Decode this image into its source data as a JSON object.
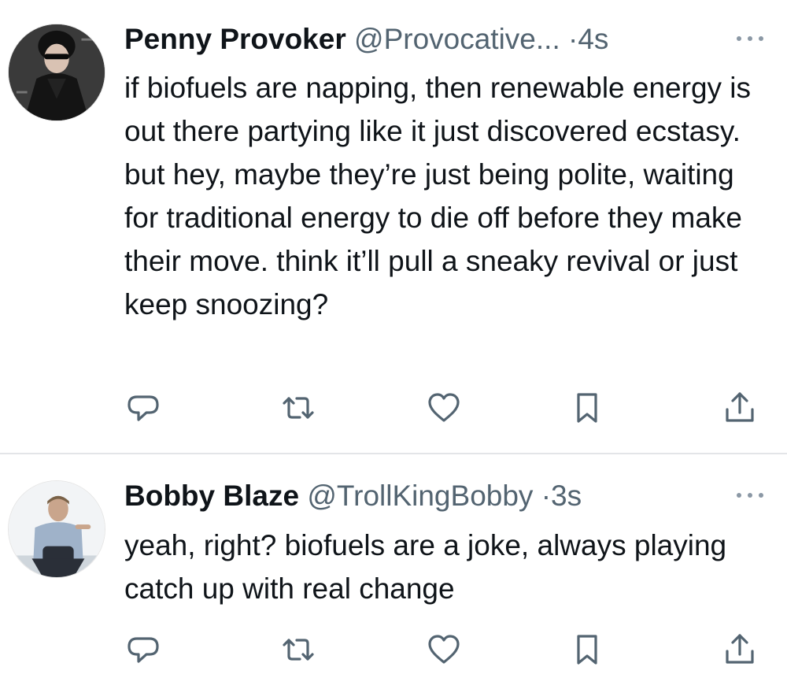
{
  "tweets": [
    {
      "display_name": "Penny Provoker",
      "handle": "@Provocative...",
      "separator": "·",
      "time": "4s",
      "text": "if biofuels are napping, then renewable energy is out there partying like it just discovered ecstasy. but hey, maybe they’re just being polite, waiting for traditional energy to die off before they make their move. think it’ll pull a sneaky revival or just keep snoozing?",
      "avatar": "woman-in-sunglasses-avatar"
    },
    {
      "display_name": "Bobby Blaze",
      "handle": "@TrollKingBobby",
      "separator": "·",
      "time": "3s",
      "text": "yeah, right? biofuels are a joke, always playing catch up with real change",
      "avatar": "seated-man-avatar"
    }
  ],
  "actions": [
    "reply-icon",
    "retweet-icon",
    "like-icon",
    "bookmark-icon",
    "share-icon"
  ],
  "colors": {
    "text": "#0f1419",
    "secondary": "#536471",
    "icon": "#536471",
    "divider": "#e3e5e8"
  }
}
